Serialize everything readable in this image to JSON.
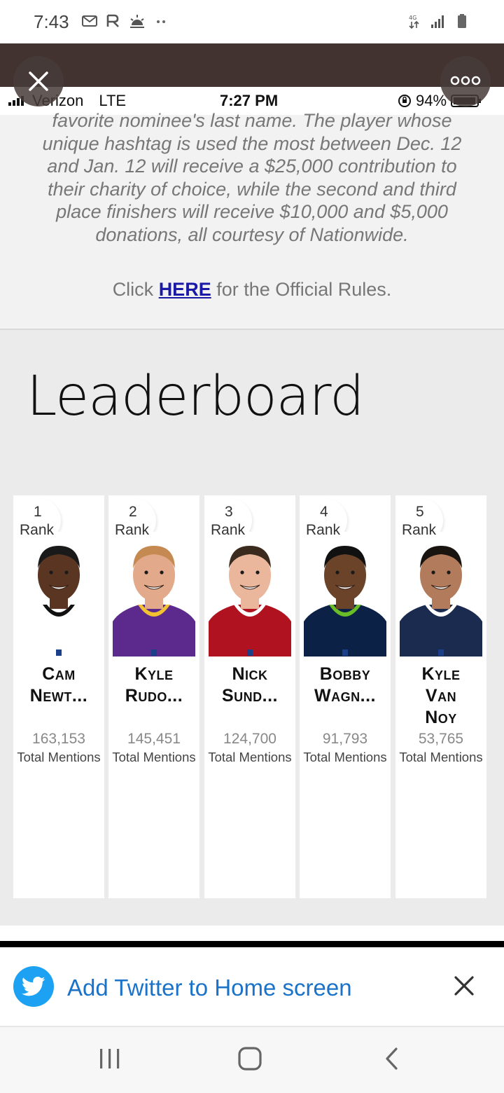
{
  "status_bar": {
    "time": "7:43",
    "network": "4G LTE"
  },
  "inner_status": {
    "carrier": "Verizon",
    "network": "LTE",
    "time": "7:27 PM",
    "battery": "94%"
  },
  "article": {
    "text_lines": [
      "favorite nominee's last name. The player whose",
      "unique hashtag is used the most between Dec. 12",
      "and Jan. 12 will receive a $25,000 contribution to",
      "their charity of choice, while the second and third",
      "place finishers will receive $10,000 and $5,000",
      "donations, all courtesy of Nationwide."
    ],
    "rules_prefix": "Click ",
    "rules_link": "HERE",
    "rules_suffix": " for the Official Rules."
  },
  "leaderboard": {
    "title": "Leaderboard",
    "rank_label": "Rank",
    "mentions_label": "Total Mentions",
    "players": [
      {
        "rank": "1",
        "name_lines": [
          "Cam",
          "Newt..."
        ],
        "mentions": "163,153",
        "jersey": "#ffffff",
        "trim": "#111111",
        "skin": "#5a3622",
        "hair": "#1a1a1a"
      },
      {
        "rank": "2",
        "name_lines": [
          "Kyle",
          "Rudo..."
        ],
        "mentions": "145,451",
        "jersey": "#5b2a8c",
        "trim": "#f2c230",
        "skin": "#e2a98a",
        "hair": "#c58a52"
      },
      {
        "rank": "3",
        "name_lines": [
          "Nick",
          "Sund..."
        ],
        "mentions": "124,700",
        "jersey": "#b0121f",
        "trim": "#ffffff",
        "skin": "#eab79c",
        "hair": "#3b2a1e"
      },
      {
        "rank": "4",
        "name_lines": [
          "Bobby",
          "Wagn..."
        ],
        "mentions": "91,793",
        "jersey": "#0b2145",
        "trim": "#69be28",
        "skin": "#6b4329",
        "hair": "#111111"
      },
      {
        "rank": "5",
        "name_lines": [
          "Kyle",
          "Van",
          "Noy"
        ],
        "mentions": "53,765",
        "jersey": "#1b2a4f",
        "trim": "#ffffff",
        "skin": "#b27b5c",
        "hair": "#1a1410"
      }
    ]
  },
  "banner": {
    "text": "Add Twitter to Home screen"
  },
  "colors": {
    "header_dark": "#433330",
    "link_blue": "#1a1aa6",
    "twitter_blue": "#1da1f2"
  }
}
